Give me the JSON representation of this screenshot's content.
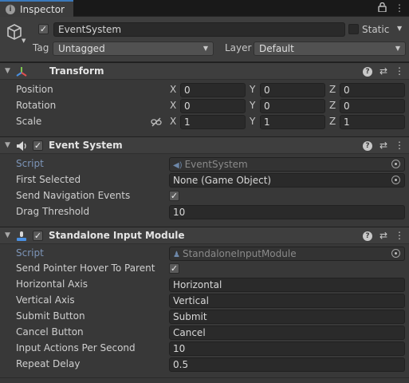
{
  "tab": {
    "label": "Inspector"
  },
  "gameobject": {
    "name": "EventSystem",
    "active": true,
    "static_label": "Static",
    "tag_label": "Tag",
    "tag_value": "Untagged",
    "layer_label": "Layer",
    "layer_value": "Default"
  },
  "transform": {
    "title": "Transform",
    "position": {
      "label": "Position",
      "x": "0",
      "y": "0",
      "z": "0"
    },
    "rotation": {
      "label": "Rotation",
      "x": "0",
      "y": "0",
      "z": "0"
    },
    "scale": {
      "label": "Scale",
      "x": "1",
      "y": "1",
      "z": "1"
    },
    "axes": {
      "x": "X",
      "y": "Y",
      "z": "Z"
    }
  },
  "event_system": {
    "title": "Event System",
    "enabled": true,
    "script_label": "Script",
    "script_value": "EventSystem",
    "first_selected_label": "First Selected",
    "first_selected_value": "None (Game Object)",
    "send_nav_label": "Send Navigation Events",
    "send_nav_checked": true,
    "drag_threshold_label": "Drag Threshold",
    "drag_threshold_value": "10"
  },
  "input_module": {
    "title": "Standalone Input Module",
    "enabled": true,
    "script_label": "Script",
    "script_value": "StandaloneInputModule",
    "hover_label": "Send Pointer Hover To Parent",
    "hover_checked": true,
    "horizontal_label": "Horizontal Axis",
    "horizontal_value": "Horizontal",
    "vertical_label": "Vertical Axis",
    "vertical_value": "Vertical",
    "submit_label": "Submit Button",
    "submit_value": "Submit",
    "cancel_label": "Cancel Button",
    "cancel_value": "Cancel",
    "actions_label": "Input Actions Per Second",
    "actions_value": "10",
    "repeat_label": "Repeat Delay",
    "repeat_value": "0.5"
  },
  "colors": {
    "accent": "#3a79bb",
    "panel": "#383838",
    "field": "#2a2a2a"
  }
}
